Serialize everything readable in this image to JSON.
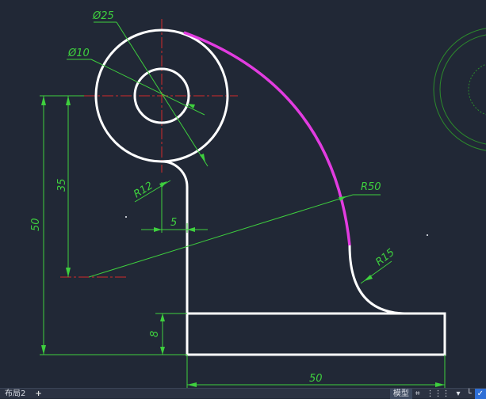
{
  "drawing": {
    "background": "#212836",
    "colors": {
      "object": "#ffffff",
      "dimension": "#3ecf3e",
      "center": "#d42a2a",
      "highlight": "#e23ce0"
    },
    "dims": {
      "d25": "Ø25",
      "d10": "Ø10",
      "r12": "R12",
      "r50": "R50",
      "r15": "R15",
      "v35": "35",
      "v50": "50",
      "v5": "5",
      "v8": "8",
      "h50": "50"
    }
  },
  "statusbar": {
    "layout_tab": "布局2",
    "add_tab": "+",
    "model": "模型",
    "grid": "⌗",
    "snap": "⋮⋮⋮",
    "dropdown": "▾",
    "ortho": "└",
    "check": "✓"
  }
}
